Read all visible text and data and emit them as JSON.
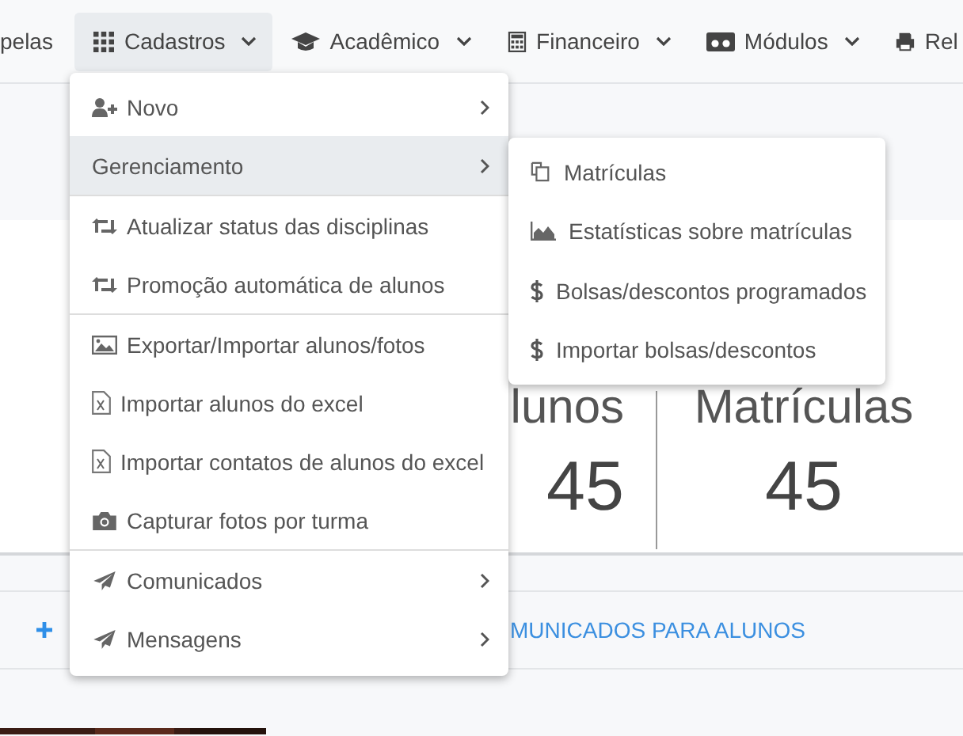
{
  "navbar": {
    "items": [
      {
        "label": "pelas",
        "selected": false
      },
      {
        "label": "Cadastros",
        "selected": true
      },
      {
        "label": "Acadêmico",
        "selected": false
      },
      {
        "label": "Financeiro",
        "selected": false
      },
      {
        "label": "Módulos",
        "selected": false
      },
      {
        "label": "Rel",
        "selected": false
      }
    ]
  },
  "cards": [
    {
      "title": "lunos",
      "value": "45"
    },
    {
      "title": "Matrículas",
      "value": "45"
    }
  ],
  "bottom_link": {
    "end": "MUNICADOS PARA ALUNOS"
  },
  "menu": {
    "items": [
      {
        "label": "Novo",
        "selected": false,
        "has_submenu": true,
        "divider_before": false
      },
      {
        "label": "Gerenciamento",
        "selected": true,
        "has_submenu": true,
        "divider_before": false
      },
      {
        "label": "Atualizar status das disciplinas",
        "selected": false,
        "has_submenu": false,
        "divider_before": true
      },
      {
        "label": "Promoção automática de alunos",
        "selected": false,
        "has_submenu": false,
        "divider_before": false
      },
      {
        "label": "Exportar/Importar alunos/fotos",
        "selected": false,
        "has_submenu": false,
        "divider_before": true
      },
      {
        "label": "Importar alunos do excel",
        "selected": false,
        "has_submenu": false,
        "divider_before": false
      },
      {
        "label": "Importar contatos de alunos do excel",
        "selected": false,
        "has_submenu": false,
        "divider_before": false
      },
      {
        "label": "Capturar fotos por turma",
        "selected": false,
        "has_submenu": false,
        "divider_before": false
      },
      {
        "label": "Comunicados",
        "selected": false,
        "has_submenu": true,
        "divider_before": true
      },
      {
        "label": "Mensagens",
        "selected": false,
        "has_submenu": true,
        "divider_before": false
      }
    ]
  },
  "submenu": {
    "items": [
      {
        "label": "Matrículas"
      },
      {
        "label": "Estatísticas sobre matrículas"
      },
      {
        "label": "Bolsas/descontos programados"
      },
      {
        "label": "Importar bolsas/descontos"
      }
    ]
  }
}
